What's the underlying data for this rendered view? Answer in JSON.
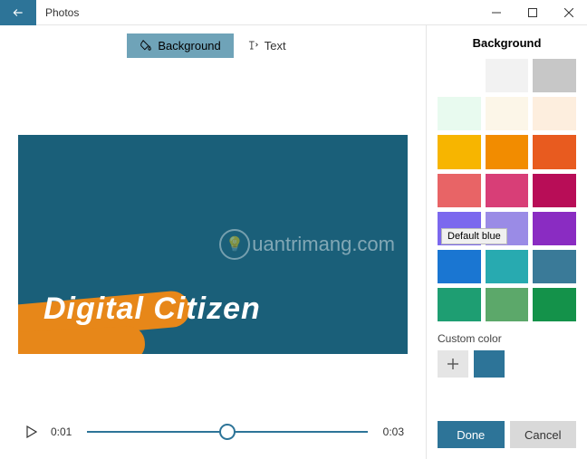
{
  "titlebar": {
    "app_name": "Photos"
  },
  "tabs": {
    "background": "Background",
    "text": "Text"
  },
  "preview": {
    "heading": "Digital Citizen",
    "watermark": "uantrimang.com"
  },
  "player": {
    "current_time": "0:01",
    "total_time": "0:03"
  },
  "panel": {
    "title": "Background",
    "swatches": [
      {
        "color": "#ffffff"
      },
      {
        "color": "#f2f2f2"
      },
      {
        "color": "#c7c7c7"
      },
      {
        "color": "#e8faef"
      },
      {
        "color": "#fcf6e8"
      },
      {
        "color": "#fdeede"
      },
      {
        "color": "#f7b500"
      },
      {
        "color": "#f28c00"
      },
      {
        "color": "#e85b1f"
      },
      {
        "color": "#e86466"
      },
      {
        "color": "#d83e77"
      },
      {
        "color": "#b80d57"
      },
      {
        "color": "#7b68ee"
      },
      {
        "color": "#9a8be6"
      },
      {
        "color": "#8a2cc2"
      },
      {
        "color": "#1a76d2",
        "tooltip": "Default blue"
      },
      {
        "color": "#28aab0"
      },
      {
        "color": "#3a7a98"
      },
      {
        "color": "#1e9e72"
      },
      {
        "color": "#5ca86a"
      },
      {
        "color": "#14924a"
      }
    ],
    "custom_label": "Custom color",
    "custom_color": "#2d7498",
    "done": "Done",
    "cancel": "Cancel"
  }
}
